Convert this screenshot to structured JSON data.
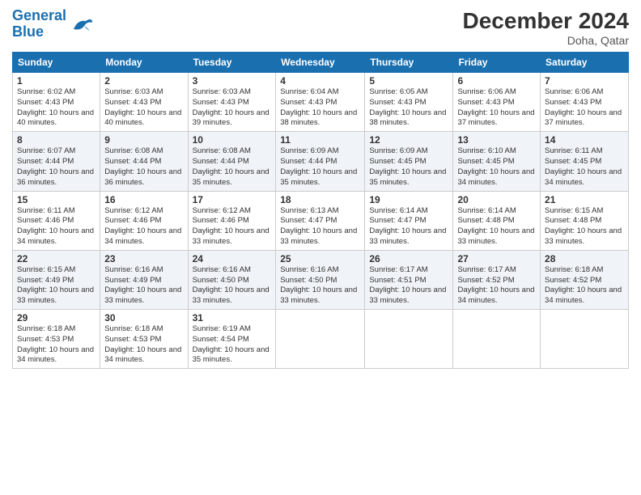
{
  "logo": {
    "line1": "General",
    "line2": "Blue"
  },
  "title": "December 2024",
  "subtitle": "Doha, Qatar",
  "days_of_week": [
    "Sunday",
    "Monday",
    "Tuesday",
    "Wednesday",
    "Thursday",
    "Friday",
    "Saturday"
  ],
  "weeks": [
    [
      {
        "day": "1",
        "sunrise": "6:02 AM",
        "sunset": "4:43 PM",
        "daylight": "10 hours and 40 minutes."
      },
      {
        "day": "2",
        "sunrise": "6:03 AM",
        "sunset": "4:43 PM",
        "daylight": "10 hours and 40 minutes."
      },
      {
        "day": "3",
        "sunrise": "6:03 AM",
        "sunset": "4:43 PM",
        "daylight": "10 hours and 39 minutes."
      },
      {
        "day": "4",
        "sunrise": "6:04 AM",
        "sunset": "4:43 PM",
        "daylight": "10 hours and 38 minutes."
      },
      {
        "day": "5",
        "sunrise": "6:05 AM",
        "sunset": "4:43 PM",
        "daylight": "10 hours and 38 minutes."
      },
      {
        "day": "6",
        "sunrise": "6:06 AM",
        "sunset": "4:43 PM",
        "daylight": "10 hours and 37 minutes."
      },
      {
        "day": "7",
        "sunrise": "6:06 AM",
        "sunset": "4:43 PM",
        "daylight": "10 hours and 37 minutes."
      }
    ],
    [
      {
        "day": "8",
        "sunrise": "6:07 AM",
        "sunset": "4:44 PM",
        "daylight": "10 hours and 36 minutes."
      },
      {
        "day": "9",
        "sunrise": "6:08 AM",
        "sunset": "4:44 PM",
        "daylight": "10 hours and 36 minutes."
      },
      {
        "day": "10",
        "sunrise": "6:08 AM",
        "sunset": "4:44 PM",
        "daylight": "10 hours and 35 minutes."
      },
      {
        "day": "11",
        "sunrise": "6:09 AM",
        "sunset": "4:44 PM",
        "daylight": "10 hours and 35 minutes."
      },
      {
        "day": "12",
        "sunrise": "6:09 AM",
        "sunset": "4:45 PM",
        "daylight": "10 hours and 35 minutes."
      },
      {
        "day": "13",
        "sunrise": "6:10 AM",
        "sunset": "4:45 PM",
        "daylight": "10 hours and 34 minutes."
      },
      {
        "day": "14",
        "sunrise": "6:11 AM",
        "sunset": "4:45 PM",
        "daylight": "10 hours and 34 minutes."
      }
    ],
    [
      {
        "day": "15",
        "sunrise": "6:11 AM",
        "sunset": "4:46 PM",
        "daylight": "10 hours and 34 minutes."
      },
      {
        "day": "16",
        "sunrise": "6:12 AM",
        "sunset": "4:46 PM",
        "daylight": "10 hours and 34 minutes."
      },
      {
        "day": "17",
        "sunrise": "6:12 AM",
        "sunset": "4:46 PM",
        "daylight": "10 hours and 33 minutes."
      },
      {
        "day": "18",
        "sunrise": "6:13 AM",
        "sunset": "4:47 PM",
        "daylight": "10 hours and 33 minutes."
      },
      {
        "day": "19",
        "sunrise": "6:14 AM",
        "sunset": "4:47 PM",
        "daylight": "10 hours and 33 minutes."
      },
      {
        "day": "20",
        "sunrise": "6:14 AM",
        "sunset": "4:48 PM",
        "daylight": "10 hours and 33 minutes."
      },
      {
        "day": "21",
        "sunrise": "6:15 AM",
        "sunset": "4:48 PM",
        "daylight": "10 hours and 33 minutes."
      }
    ],
    [
      {
        "day": "22",
        "sunrise": "6:15 AM",
        "sunset": "4:49 PM",
        "daylight": "10 hours and 33 minutes."
      },
      {
        "day": "23",
        "sunrise": "6:16 AM",
        "sunset": "4:49 PM",
        "daylight": "10 hours and 33 minutes."
      },
      {
        "day": "24",
        "sunrise": "6:16 AM",
        "sunset": "4:50 PM",
        "daylight": "10 hours and 33 minutes."
      },
      {
        "day": "25",
        "sunrise": "6:16 AM",
        "sunset": "4:50 PM",
        "daylight": "10 hours and 33 minutes."
      },
      {
        "day": "26",
        "sunrise": "6:17 AM",
        "sunset": "4:51 PM",
        "daylight": "10 hours and 33 minutes."
      },
      {
        "day": "27",
        "sunrise": "6:17 AM",
        "sunset": "4:52 PM",
        "daylight": "10 hours and 34 minutes."
      },
      {
        "day": "28",
        "sunrise": "6:18 AM",
        "sunset": "4:52 PM",
        "daylight": "10 hours and 34 minutes."
      }
    ],
    [
      {
        "day": "29",
        "sunrise": "6:18 AM",
        "sunset": "4:53 PM",
        "daylight": "10 hours and 34 minutes."
      },
      {
        "day": "30",
        "sunrise": "6:18 AM",
        "sunset": "4:53 PM",
        "daylight": "10 hours and 34 minutes."
      },
      {
        "day": "31",
        "sunrise": "6:19 AM",
        "sunset": "4:54 PM",
        "daylight": "10 hours and 35 minutes."
      },
      null,
      null,
      null,
      null
    ]
  ]
}
